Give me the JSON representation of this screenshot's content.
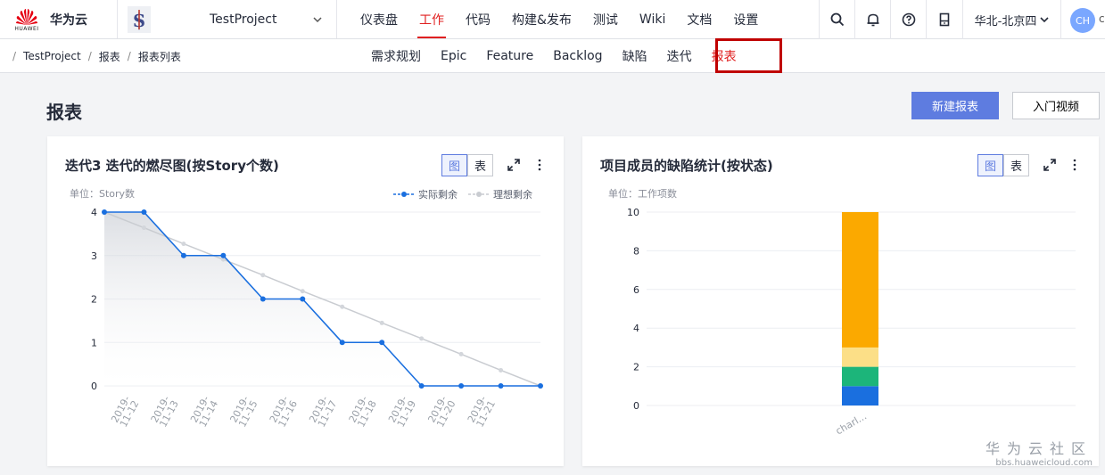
{
  "header": {
    "brand_name": "华为云",
    "logo_text": "HUAWEI",
    "project": "TestProject",
    "nav": [
      {
        "label": "仪表盘",
        "active": false
      },
      {
        "label": "工作",
        "active": true
      },
      {
        "label": "代码",
        "active": false
      },
      {
        "label": "构建&发布",
        "active": false
      },
      {
        "label": "测试",
        "active": false
      },
      {
        "label": "Wiki",
        "active": false
      },
      {
        "label": "文档",
        "active": false
      },
      {
        "label": "设置",
        "active": false
      }
    ],
    "region": "华北-北京四",
    "avatar": "CH",
    "avatar_extra": "c"
  },
  "breadcrumb": [
    "TestProject",
    "报表",
    "报表列表"
  ],
  "subnav": [
    {
      "label": "需求规划",
      "active": false
    },
    {
      "label": "Epic",
      "active": false
    },
    {
      "label": "Feature",
      "active": false
    },
    {
      "label": "Backlog",
      "active": false
    },
    {
      "label": "缺陷",
      "active": false
    },
    {
      "label": "迭代",
      "active": false
    },
    {
      "label": "报表",
      "active": true
    }
  ],
  "page": {
    "title": "报表",
    "new_report": "新建报表",
    "intro_video": "入门视频"
  },
  "cards": [
    {
      "title": "迭代3 迭代的燃尽图(按Story个数)",
      "toggle_chart": "图",
      "toggle_table": "表",
      "unit": "单位：Story数"
    },
    {
      "title": "项目成员的缺陷统计(按状态)",
      "toggle_chart": "图",
      "toggle_table": "表",
      "unit": "单位：工作项数"
    }
  ],
  "watermark": {
    "big": "华为云社区",
    "small": "bbs.huaweicloud.com"
  },
  "colors": {
    "accent": "#5e7ce0",
    "active_nav": "#e02020",
    "actual_line": "#1a6fdf",
    "ideal_line": "#c9ccd1"
  },
  "chart_data": [
    {
      "type": "line",
      "title": "迭代3 迭代的燃尽图(按Story个数)",
      "ylabel": "单位：Story数",
      "categories": [
        "2019-11-12",
        "2019-11-13",
        "2019-11-14",
        "2019-11-15",
        "2019-11-16",
        "2019-11-17",
        "2019-11-18",
        "2019-11-19",
        "2019-11-20",
        "2019-11-21"
      ],
      "tick_labels": [
        [
          "2019-",
          "11-12"
        ],
        [
          "2019-",
          "11-13"
        ],
        [
          "2019-",
          "11-14"
        ],
        [
          "2019-",
          "11-15"
        ],
        [
          "2019-",
          "11-16"
        ],
        [
          "2019-",
          "11-17"
        ],
        [
          "2019-",
          "11-18"
        ],
        [
          "2019-",
          "11-19"
        ],
        [
          "2019-",
          "11-20"
        ],
        [
          "2019-",
          "11-21"
        ]
      ],
      "ylim": [
        0,
        4
      ],
      "yticks": [
        0,
        1,
        2,
        3,
        4
      ],
      "grid": true,
      "legend": "top-right",
      "series": [
        {
          "name": "实际剩余",
          "values": [
            4,
            4,
            3,
            3,
            2,
            2,
            1,
            1,
            0,
            0,
            0,
            0
          ]
        },
        {
          "name": "理想剩余",
          "values": [
            4,
            3.64,
            3.27,
            2.91,
            2.55,
            2.18,
            1.82,
            1.45,
            1.09,
            0.73,
            0.36,
            0
          ]
        }
      ]
    },
    {
      "type": "bar",
      "title": "项目成员的缺陷统计(按状态)",
      "ylabel": "单位：工作项数",
      "categories": [
        "charl..."
      ],
      "ylim": [
        0,
        10
      ],
      "yticks": [
        0,
        2,
        4,
        6,
        8,
        10
      ],
      "grid": true,
      "stacked": true,
      "series": [
        {
          "values": [
            1
          ],
          "color": "#1a6fdf"
        },
        {
          "values": [
            1
          ],
          "color": "#1cb57a"
        },
        {
          "values": [
            1
          ],
          "color": "#fcdf87"
        },
        {
          "values": [
            7
          ],
          "color": "#fba900"
        }
      ]
    }
  ]
}
